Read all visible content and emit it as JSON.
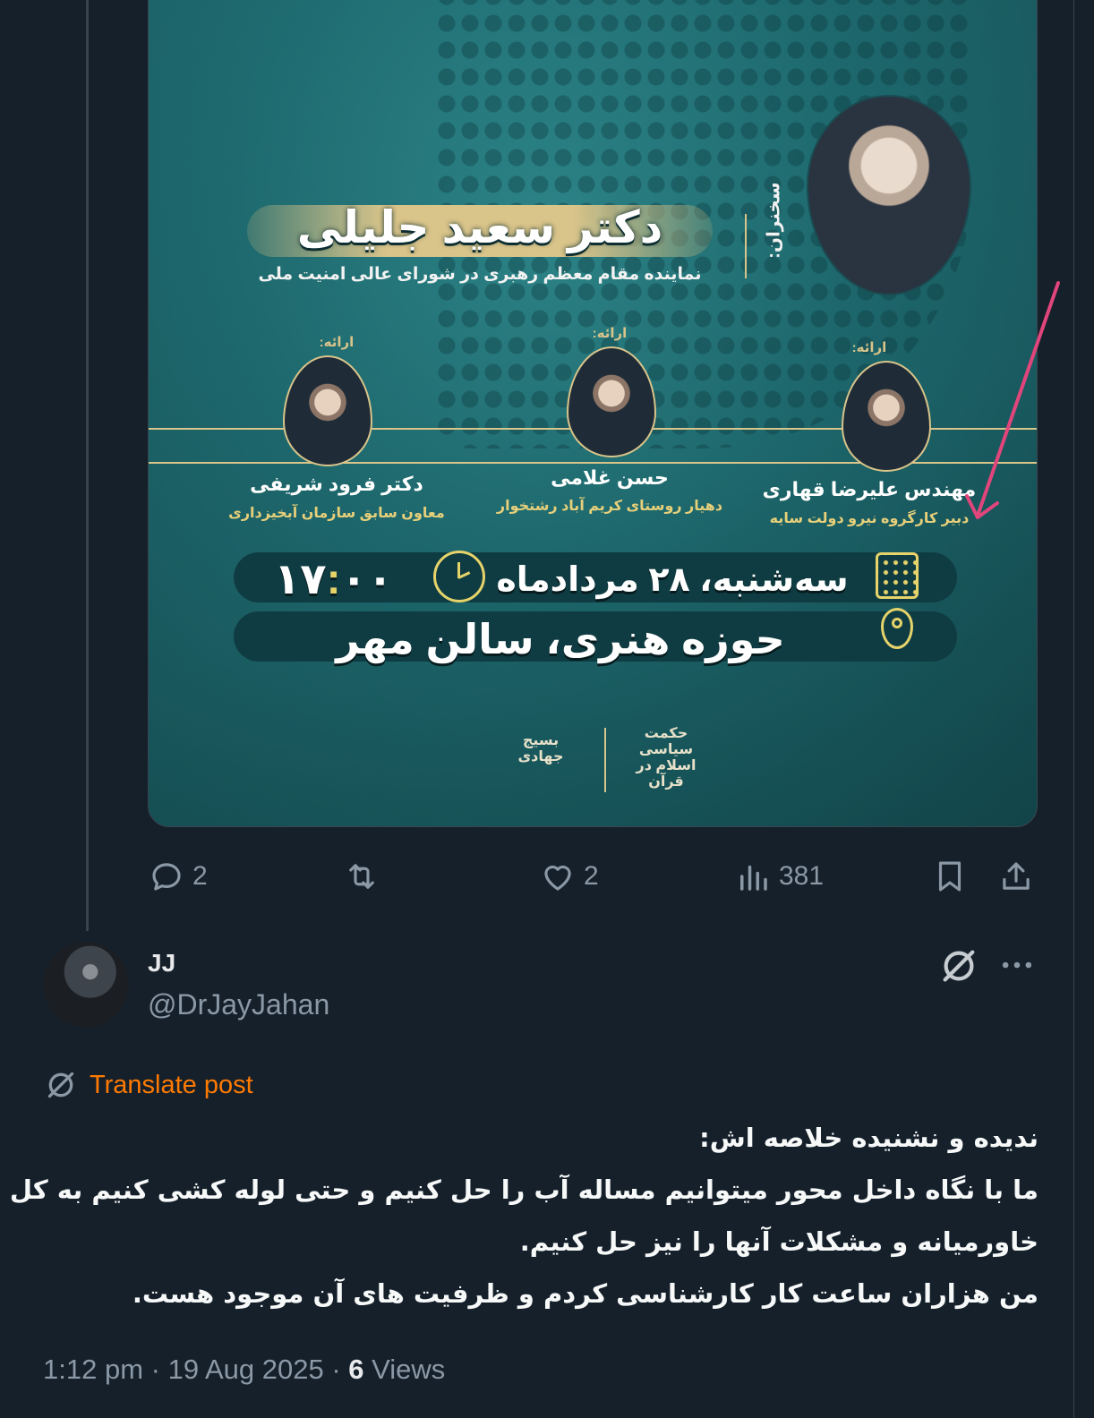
{
  "poster": {
    "keynote_label": "سخنران:",
    "keynote_name": "دکتر سعید جلیلی",
    "keynote_title": "نماینده مقام معظم رهبری در شورای عالی امنیت ملی",
    "presenters": [
      {
        "label": "ارائه:",
        "name": "مهندس علیرضا قهاری",
        "role": "دبیر کارگروه نیرو دولت سایه"
      },
      {
        "label": "ارائه:",
        "name": "حسن غلامی",
        "role": "دهیار روستای کریم آباد رشتخوار"
      },
      {
        "label": "ارائه:",
        "name": "دکتر فرود شریفی",
        "role": "معاون سابق سازمان آبخیزداری"
      }
    ],
    "date": "سه‌شنبه، ۲۸ مردادماه",
    "time_hours": "۱۷",
    "time_sep": ":",
    "time_minutes": "۰۰",
    "venue": "حوزه هنری، سالن مهر",
    "logo_right": "حکمت سیاسی اسلام در قرآن",
    "logo_left": "بسیج جهادی"
  },
  "actions": {
    "replies": "2",
    "reposts": "",
    "likes": "2",
    "views": "381"
  },
  "reply": {
    "display_name": "JJ",
    "handle": "@DrJayJahan",
    "translate_label": "Translate post",
    "body_lines": [
      "ندیده و نشنیده خلاصه اش:",
      "ما با نگاه داخل محور میتوانیم مساله آب را حل کنیم و حتی لوله کشی کنیم به کل",
      "خاورمیانه و مشکلات آنها را نیز حل کنیم.",
      "من هزاران ساعت کار کارشناسی کردم و ظرفیت های آن موجود هست."
    ],
    "time": "1:12 pm",
    "date": "19 Aug 2025",
    "views_count": "6",
    "views_label": "Views"
  },
  "colors": {
    "background": "#15202b",
    "muted_text": "#8b98a5",
    "translate_accent": "#ff7a00",
    "poster_gold": "#d9c48a",
    "annotation_arrow": "#e0457b"
  }
}
